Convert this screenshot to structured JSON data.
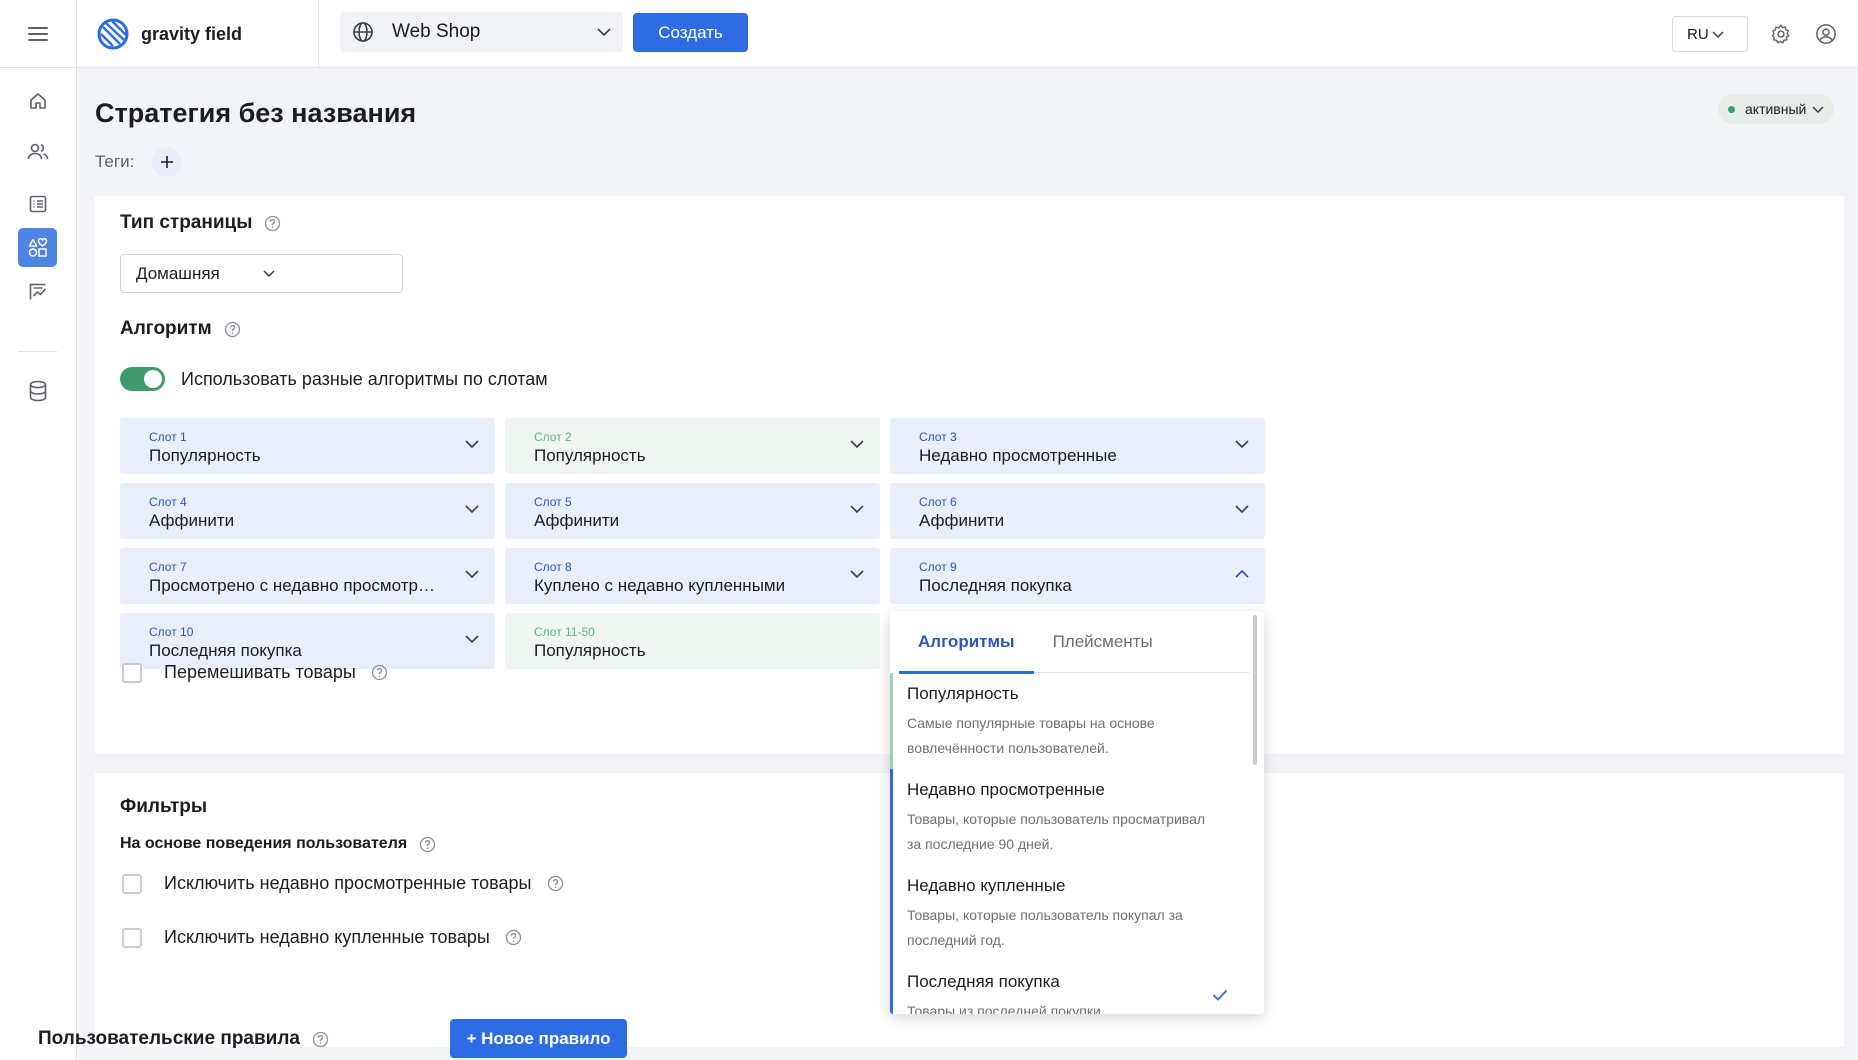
{
  "header": {
    "brand": "gravity field",
    "shop_selector": "Web Shop",
    "create_label": "Создать",
    "language": "RU"
  },
  "page": {
    "title": "Стратегия без названия",
    "status": "активный",
    "tags_label": "Теги:"
  },
  "page_type": {
    "title": "Тип страницы",
    "value": "Домашняя"
  },
  "algorithm": {
    "title": "Алгоритм",
    "toggle_label": "Использовать разные алгоритмы по слотам",
    "toggle_on": true,
    "slots": [
      {
        "label": "Слот 1",
        "value": "Популярность"
      },
      {
        "label": "Слот 2",
        "value": "Популярность"
      },
      {
        "label": "Слот 3",
        "value": "Недавно просмотренные"
      },
      {
        "label": "Слот 4",
        "value": "Аффинити"
      },
      {
        "label": "Слот 5",
        "value": "Аффинити"
      },
      {
        "label": "Слот 6",
        "value": "Аффинити"
      },
      {
        "label": "Слот 7",
        "value": "Просмотрено с недавно просмотренными"
      },
      {
        "label": "Слот 8",
        "value": "Куплено с недавно купленными"
      },
      {
        "label": "Слот 9",
        "value": "Последняя покупка"
      },
      {
        "label": "Слот 10",
        "value": "Последняя покупка"
      },
      {
        "label": "Слот 11-50",
        "value": "Популярность"
      }
    ],
    "shuffle_label": "Перемешивать товары"
  },
  "filters": {
    "title": "Фильтры",
    "behavior_title": "На основе поведения пользователя",
    "exclude_viewed": "Исключить недавно просмотренные товары",
    "exclude_purchased": "Исключить недавно купленные товары"
  },
  "rules": {
    "title": "Пользовательские правила",
    "new_rule_label": "+ Новое правило"
  },
  "dropdown": {
    "tabs": [
      "Алгоритмы",
      "Плейсменты"
    ],
    "items": [
      {
        "title": "Популярность",
        "desc1": "Самые популярные товары на основе",
        "desc2": "вовлечённости пользователей."
      },
      {
        "title": "Недавно просмотренные",
        "desc1": "Товары, которые пользователь просматривал",
        "desc2": "за последние 90 дней."
      },
      {
        "title": "Недавно купленные",
        "desc1": "Товары, которые пользователь покупал за",
        "desc2": "последний год."
      },
      {
        "title": "Последняя покупка",
        "desc1": "Товары из последней покупки",
        "desc2": ""
      }
    ]
  },
  "colors": {
    "primary": "#2d6ce3",
    "active_status": "#33a36c",
    "toggle_on": "#3f9a6e"
  }
}
